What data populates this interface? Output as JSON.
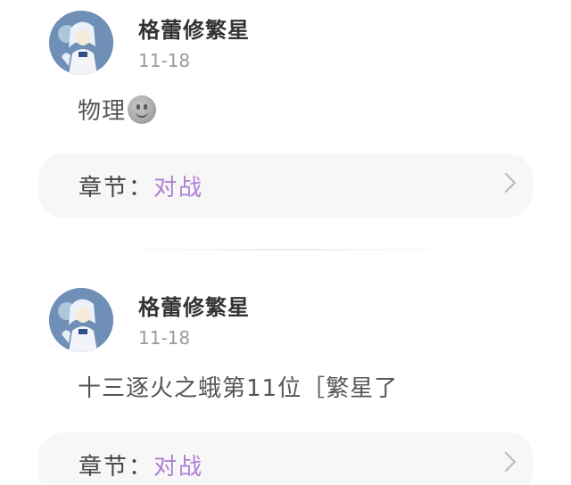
{
  "colors": {
    "chapter_accent": "#b07fd6",
    "card_background": "#f7f7f7",
    "date_text": "#9a9a9a"
  },
  "posts": [
    {
      "username": "格蕾修繁星",
      "date": "11-18",
      "content": "物理",
      "content_emoji": "smile-emoji-icon",
      "chapter_label": "章节：",
      "chapter_name": "对战"
    },
    {
      "username": "格蕾修繁星",
      "date": "11-18",
      "content": "十三逐火之蛾第11位［繁星了",
      "chapter_label": "章节：",
      "chapter_name": "对战"
    }
  ]
}
